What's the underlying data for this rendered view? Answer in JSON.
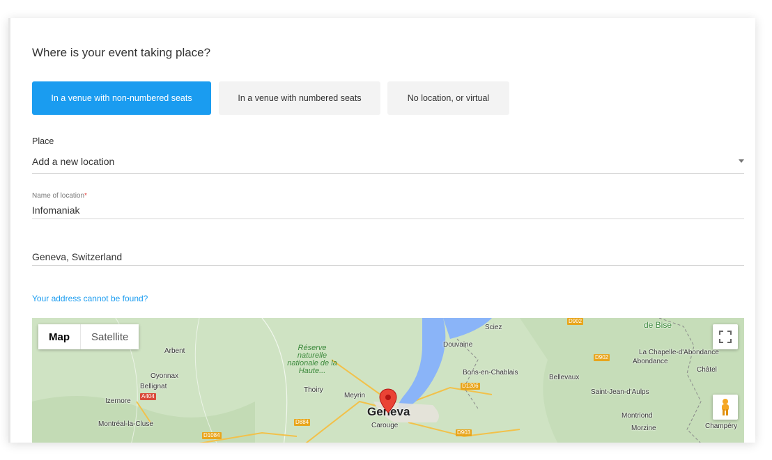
{
  "question": "Where is your event taking place?",
  "location_types": {
    "non_numbered": "In a venue with non-numbered seats",
    "numbered": "In a venue with numbered seats",
    "virtual": "No location, or virtual"
  },
  "place": {
    "label": "Place",
    "selected": "Add a new location"
  },
  "name_of_location": {
    "label": "Name of location",
    "required_mark": "*",
    "value": "Infomaniak"
  },
  "address": {
    "value": "Geneva, Switzerland"
  },
  "address_not_found_link": "Your address cannot be found?",
  "map": {
    "map_button": "Map",
    "satellite_button": "Satellite",
    "icons": {
      "fullscreen": "fullscreen-icon",
      "pegman": "pegman-icon",
      "pin": "location-pin-icon"
    },
    "places": {
      "geneva": "Geneva",
      "carouge": "Carouge",
      "meyrin": "Meyrin",
      "thoiry": "Thoiry",
      "arbent": "Arbent",
      "oyonnax": "Oyonnax",
      "bellignat": "Bellignat",
      "izernore": "Izernore",
      "montreal": "Montréal-la-Cluse",
      "sciez": "Sciez",
      "douvaine": "Douvaine",
      "bons": "Bons-en-Chablais",
      "bellevaux": "Bellevaux",
      "saint_jean": "Saint-Jean-d'Aulps",
      "montriond": "Montriond",
      "morzine": "Morzine",
      "champery": "Champéry",
      "chatel": "Châtel",
      "chapelle": "La Chapelle-d'Abondance",
      "abondance": "Abondance",
      "de_bise": "de Bise",
      "reserve": "Réserve naturelle nationale de la Haute..."
    },
    "roads": {
      "a404": "A404",
      "d884": "D884",
      "d1084": "D1084",
      "d1206": "D1206",
      "d902a": "D902",
      "d902b": "D902",
      "d903": "D903"
    }
  },
  "colors": {
    "accent": "#1a9cf0",
    "required": "#e53935",
    "lake": "#8ab4f8",
    "terrain": "#cfe3c3"
  }
}
